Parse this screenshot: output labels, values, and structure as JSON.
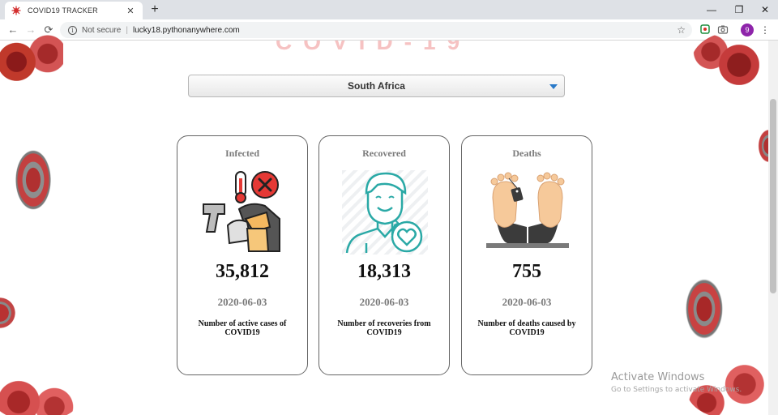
{
  "browser": {
    "tab": {
      "title": "COVID19 TRACKER"
    },
    "address": {
      "security": "Not secure",
      "url": "lucky18.pythonanywhere.com"
    },
    "profile_initial": "9"
  },
  "page": {
    "header_title": "COVID-19",
    "country_select": {
      "selected": "South Africa"
    },
    "cards": [
      {
        "label": "Infected",
        "count": "35,812",
        "date": "2020-06-03",
        "description": "Number of active cases of COVID19",
        "icon": "thermometer-scan-icon"
      },
      {
        "label": "Recovered",
        "count": "18,313",
        "date": "2020-06-03",
        "description": "Number of recoveries from COVID19",
        "icon": "recovered-person-icon"
      },
      {
        "label": "Deaths",
        "count": "755",
        "date": "2020-06-03",
        "description": "Number of deaths caused by COVID19",
        "icon": "toe-tag-icon"
      }
    ]
  },
  "os_watermark": {
    "line1": "Activate Windows",
    "line2": "Go to Settings to activate Windows."
  },
  "colors": {
    "virus_red": "#c0392b",
    "card_border": "#666666",
    "label_grey": "#7a7a7a",
    "select_caret": "#2979c8",
    "recovered_teal": "#2aa9a6"
  }
}
